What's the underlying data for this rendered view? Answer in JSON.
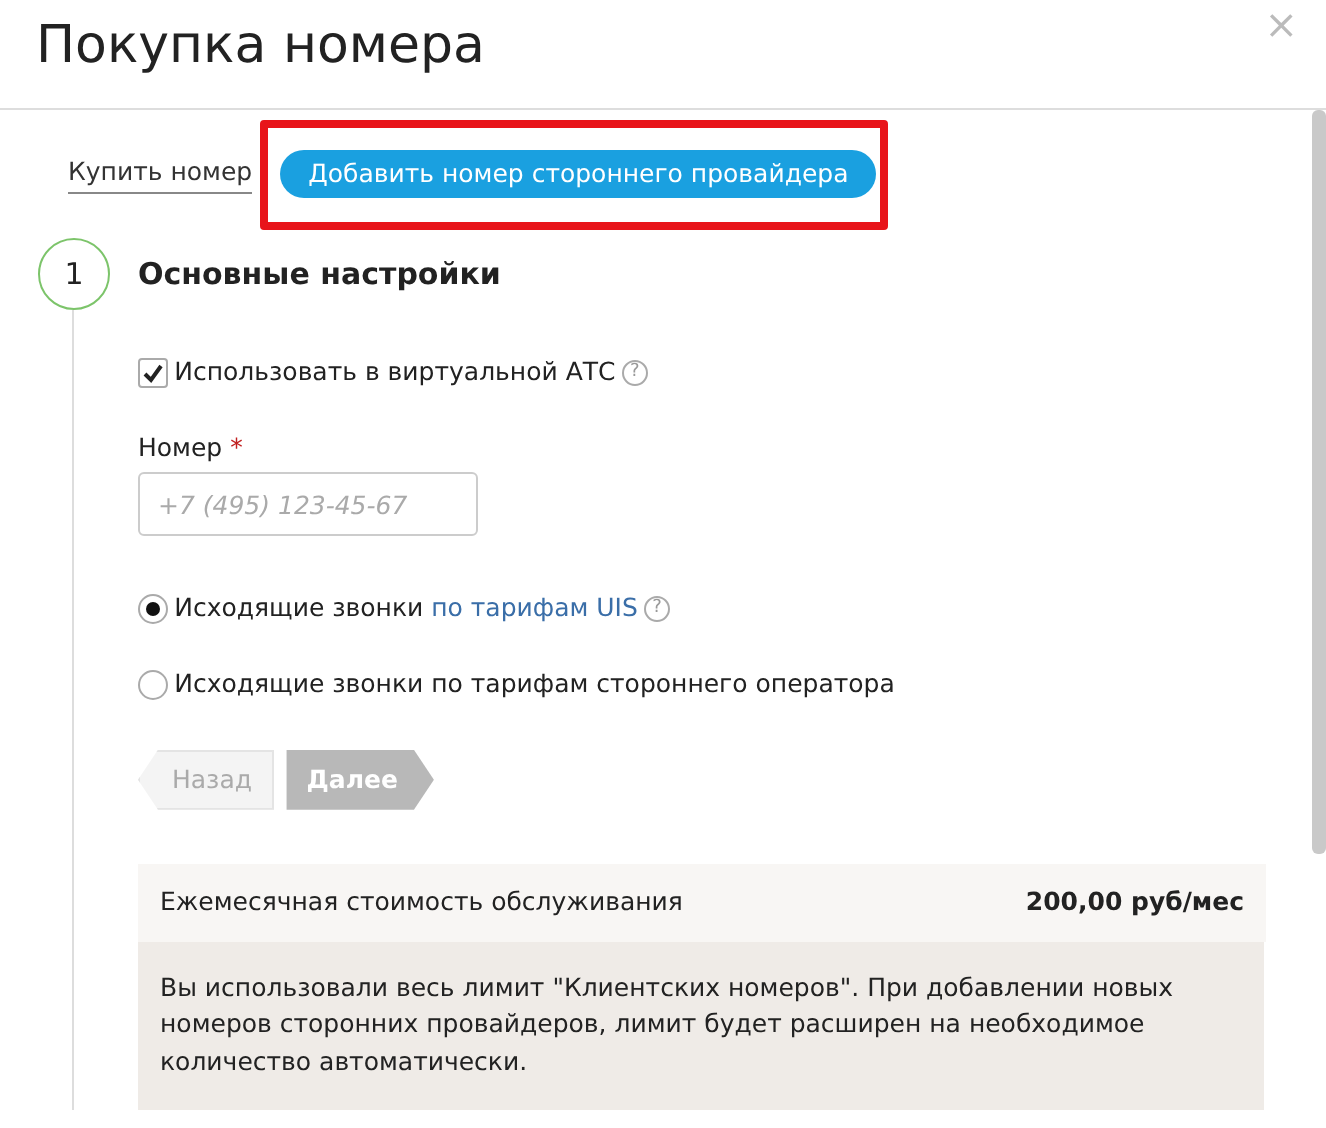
{
  "dialog": {
    "title": "Покупка номера",
    "close": "×"
  },
  "tabs": [
    {
      "label": "Купить номер",
      "selected": false,
      "highlighted": false
    },
    {
      "label": "Добавить номер стороннего провайдера",
      "selected": true,
      "highlighted": true
    }
  ],
  "step": {
    "number": "1",
    "title": "Основные настройки"
  },
  "checkbox": {
    "label": "Использовать в виртуальной АТС",
    "checked": true,
    "help": "?"
  },
  "number_field": {
    "label": "Номер",
    "required": "*",
    "placeholder": "+7 (495) 123-45-67"
  },
  "radios": [
    {
      "text": "Исходящие звонки ",
      "link": "по тарифам UIS",
      "help": "?",
      "selected": true
    },
    {
      "text": "Исходящие звонки по тарифам стороннего оператора",
      "selected": false
    }
  ],
  "buttons": [
    {
      "label": "Назад",
      "kind": "back",
      "disabled": true
    },
    {
      "label": "Далее",
      "kind": "next",
      "disabled": true
    }
  ],
  "cost": {
    "label": "Ежемесячная стоимость обслуживания",
    "value": "200,00 руб/мес",
    "note": "Вы использовали весь лимит \"Клиентских номеров\". При добавлении новых номеров сторонних провайдеров, лимит будет расширен на необходимое количество автоматически."
  }
}
